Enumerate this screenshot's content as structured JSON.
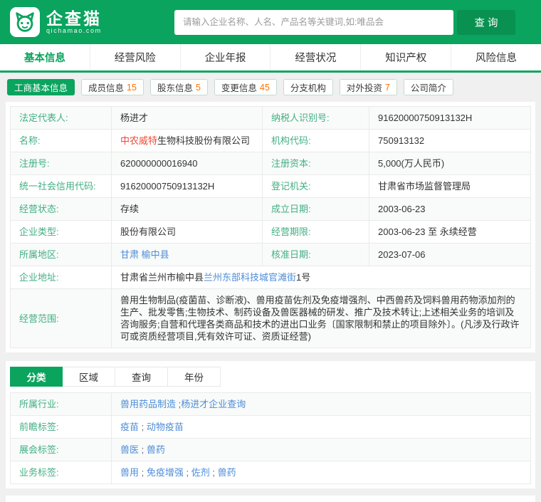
{
  "header": {
    "brand": "企查猫",
    "brand_sub": "qichamao.com",
    "search": {
      "placeholder": "请输入企业名称、人名、产品名等关键词,如:唯品会",
      "button": "查询"
    }
  },
  "nav": {
    "tabs": [
      "基本信息",
      "经营风险",
      "企业年报",
      "经营状况",
      "知识产权",
      "风险信息"
    ],
    "active": "基本信息"
  },
  "subnav": {
    "items": [
      {
        "label": "工商基本信息",
        "count": ""
      },
      {
        "label": "成员信息",
        "count": "15"
      },
      {
        "label": "股东信息",
        "count": "5"
      },
      {
        "label": "变更信息",
        "count": "45"
      },
      {
        "label": "分支机构",
        "count": ""
      },
      {
        "label": "对外投资",
        "count": "7"
      },
      {
        "label": "公司简介",
        "count": ""
      }
    ]
  },
  "info": {
    "rows": [
      {
        "l1": "法定代表人:",
        "v1": [
          {
            "text": "杨进才",
            "style": "plain"
          }
        ],
        "l2": "纳税人识别号:",
        "v2": [
          {
            "text": "91620000750913132H",
            "style": "plain"
          }
        ]
      },
      {
        "l1": "名称:",
        "v1": [
          {
            "text": "中农威特",
            "style": "hl"
          },
          {
            "text": "生物科技股份有限公司",
            "style": "plain"
          }
        ],
        "l2": "机构代码:",
        "v2": [
          {
            "text": "750913132",
            "style": "plain"
          }
        ]
      },
      {
        "l1": "注册号:",
        "v1": [
          {
            "text": "620000000016940",
            "style": "plain"
          }
        ],
        "l2": "注册资本:",
        "v2": [
          {
            "text": "5,000(万人民币)",
            "style": "plain"
          }
        ]
      },
      {
        "l1": "统一社会信用代码:",
        "v1": [
          {
            "text": "91620000750913132H",
            "style": "plain"
          }
        ],
        "l2": "登记机关:",
        "v2": [
          {
            "text": "甘肃省市场监督管理局",
            "style": "plain"
          }
        ]
      },
      {
        "l1": "经营状态:",
        "v1": [
          {
            "text": "存续",
            "style": "plain"
          }
        ],
        "l2": "成立日期:",
        "v2": [
          {
            "text": "2003-06-23",
            "style": "plain"
          }
        ]
      },
      {
        "l1": "企业类型:",
        "v1": [
          {
            "text": "股份有限公司",
            "style": "plain"
          }
        ],
        "l2": "经营期限:",
        "v2": [
          {
            "text": "2003-06-23 至 永续经营",
            "style": "plain"
          }
        ]
      },
      {
        "l1": "所属地区:",
        "v1": [
          {
            "text": "甘肃 榆中县",
            "style": "link"
          }
        ],
        "l2": "核准日期:",
        "v2": [
          {
            "text": "2023-07-06",
            "style": "plain"
          }
        ]
      }
    ],
    "address": {
      "label": "企业地址:",
      "parts": [
        {
          "text": "甘肃省兰州市榆中县",
          "style": "plain"
        },
        {
          "text": "兰州东部科技城官滩街",
          "style": "link"
        },
        {
          "text": "1号",
          "style": "plain"
        }
      ]
    },
    "scope": {
      "label": "经营范围:",
      "parts": [
        {
          "text": "兽用生物制品(疫菌苗、诊断液)、兽用疫苗佐剂及免疫增强剂、中西兽药及饲料兽用药物添加剂的生产、批发零售;生物技术、制药设备及兽医器械的研发、推广及技术转让;上述相关业务的培训及咨询服务;自营和代理各类商品和技术的进出口业务〔国家限制和禁止的项目除外〕。(凡涉及行政许可或资质经营项目,凭有效许可证、资质证经营)",
          "style": "plain"
        }
      ]
    }
  },
  "filter_tabs": {
    "tabs": [
      "分类",
      "区域",
      "查询",
      "年份"
    ],
    "active": "分类"
  },
  "tags": {
    "rows": [
      {
        "label": "所属行业:",
        "parts": [
          {
            "text": "兽用药品制造",
            "style": "link"
          },
          {
            "text": " ;",
            "style": "sep"
          },
          {
            "text": "杨进才企业查询",
            "style": "link"
          }
        ]
      },
      {
        "label": "前瞻标签:",
        "parts": [
          {
            "text": "疫苗",
            "style": "link"
          },
          {
            "text": " ; ",
            "style": "sep"
          },
          {
            "text": "动物疫苗",
            "style": "link"
          }
        ]
      },
      {
        "label": "展会标签:",
        "parts": [
          {
            "text": "兽医",
            "style": "link"
          },
          {
            "text": " ; ",
            "style": "sep"
          },
          {
            "text": "兽药",
            "style": "link"
          }
        ]
      },
      {
        "label": "业务标签:",
        "parts": [
          {
            "text": "兽用",
            "style": "link"
          },
          {
            "text": " ; ",
            "style": "sep"
          },
          {
            "text": "免疫增强",
            "style": "link"
          },
          {
            "text": " ; ",
            "style": "sep"
          },
          {
            "text": "佐剂",
            "style": "link"
          },
          {
            "text": " ; ",
            "style": "sep"
          },
          {
            "text": "兽药",
            "style": "link"
          }
        ]
      }
    ]
  },
  "colors": {
    "brand_green": "#0aa45e",
    "button_green": "#089150",
    "label_green": "#43af85",
    "link_blue": "#4e8cd8",
    "highlight_red": "#ee4936",
    "count_orange": "#ff7300"
  }
}
